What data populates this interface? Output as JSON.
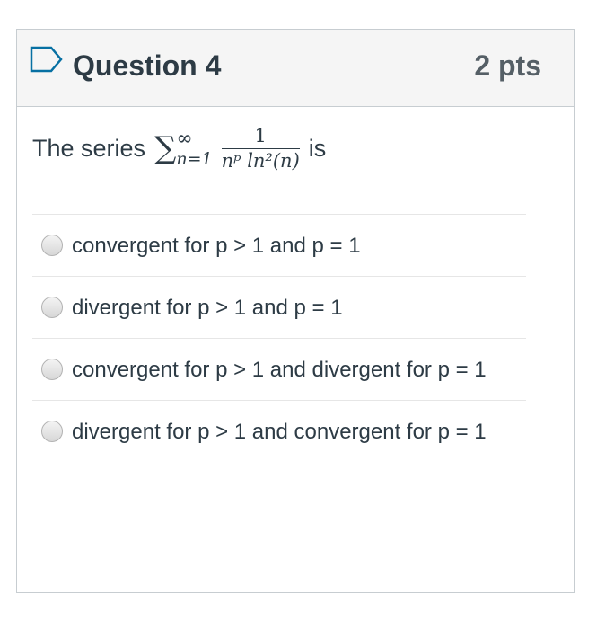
{
  "question": {
    "title": "Question 4",
    "points": "2 pts",
    "text_before": "The series",
    "text_after": "is",
    "math": {
      "sigma": "∑",
      "upper_limit": "∞",
      "lower_limit": "n=1",
      "numerator": "1",
      "denominator": "nᵖ ln²(n)"
    }
  },
  "answers": [
    {
      "label": "convergent for p > 1 and p = 1"
    },
    {
      "label": "divergent for p > 1 and p = 1"
    },
    {
      "label": "convergent for p > 1 and divergent for p = 1"
    },
    {
      "label": "divergent for p > 1 and convergent for p = 1"
    }
  ],
  "colors": {
    "header_bg": "#f5f5f5",
    "border": "#c7cdd1",
    "text": "#2d3b45",
    "flag": "#0770a3"
  }
}
